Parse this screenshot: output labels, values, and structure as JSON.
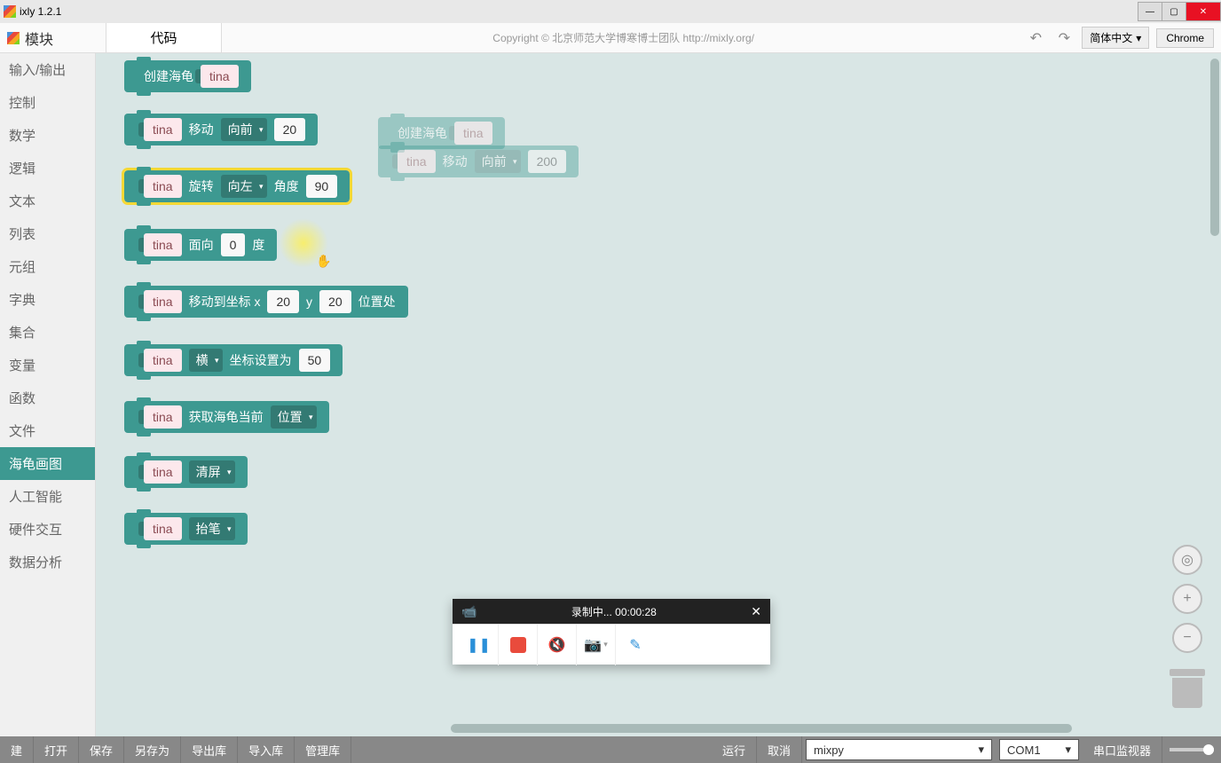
{
  "window": {
    "title": "ixly 1.2.1"
  },
  "toolbar": {
    "module_tab": "模块",
    "code_tab": "代码",
    "copyright": "Copyright © 北京师范大学博寒博士团队 http://mixly.org/",
    "language": "简体中文",
    "browser": "Chrome"
  },
  "sidebar": {
    "items": [
      {
        "label": "输入/输出"
      },
      {
        "label": "控制"
      },
      {
        "label": "数学"
      },
      {
        "label": "逻辑"
      },
      {
        "label": "文本"
      },
      {
        "label": "列表"
      },
      {
        "label": "元组"
      },
      {
        "label": "字典"
      },
      {
        "label": "集合"
      },
      {
        "label": "变量"
      },
      {
        "label": "函数"
      },
      {
        "label": "文件"
      },
      {
        "label": "海龟画图"
      },
      {
        "label": "人工智能"
      },
      {
        "label": "硬件交互"
      },
      {
        "label": "数据分析"
      }
    ],
    "active_index": 12
  },
  "blocks": {
    "create": {
      "label": "创建海龟",
      "name": "tina"
    },
    "move": {
      "name": "tina",
      "action": "移动",
      "direction": "向前",
      "value": "20"
    },
    "rotate": {
      "name": "tina",
      "action": "旋转",
      "direction": "向左",
      "degree_label": "角度",
      "value": "90"
    },
    "face": {
      "name": "tina",
      "action": "面向",
      "value": "0",
      "unit": "度"
    },
    "goto": {
      "name": "tina",
      "action": "移动到坐标 x",
      "x": "20",
      "y_label": "y",
      "y": "20",
      "suffix": "位置处"
    },
    "setcoord": {
      "name": "tina",
      "axis": "横",
      "label": "坐标设置为",
      "value": "50"
    },
    "getpos": {
      "name": "tina",
      "label": "获取海龟当前",
      "option": "位置"
    },
    "clear": {
      "name": "tina",
      "action": "清屏"
    },
    "penup": {
      "name": "tina",
      "action": "抬笔"
    }
  },
  "canvas_blocks": {
    "create": {
      "label": "创建海龟",
      "name": "tina"
    },
    "move": {
      "name": "tina",
      "action": "移动",
      "direction": "向前",
      "value": "200"
    }
  },
  "bottombar": {
    "new": "建",
    "open": "打开",
    "save": "保存",
    "saveas": "另存为",
    "exportlib": "导出库",
    "importlib": "导入库",
    "managelib": "管理库",
    "run": "运行",
    "cancel": "取消",
    "mixpy": "mixpy",
    "com": "COM1",
    "serial": "串口监视器"
  },
  "recorder": {
    "status": "录制中... 00:00:28"
  }
}
